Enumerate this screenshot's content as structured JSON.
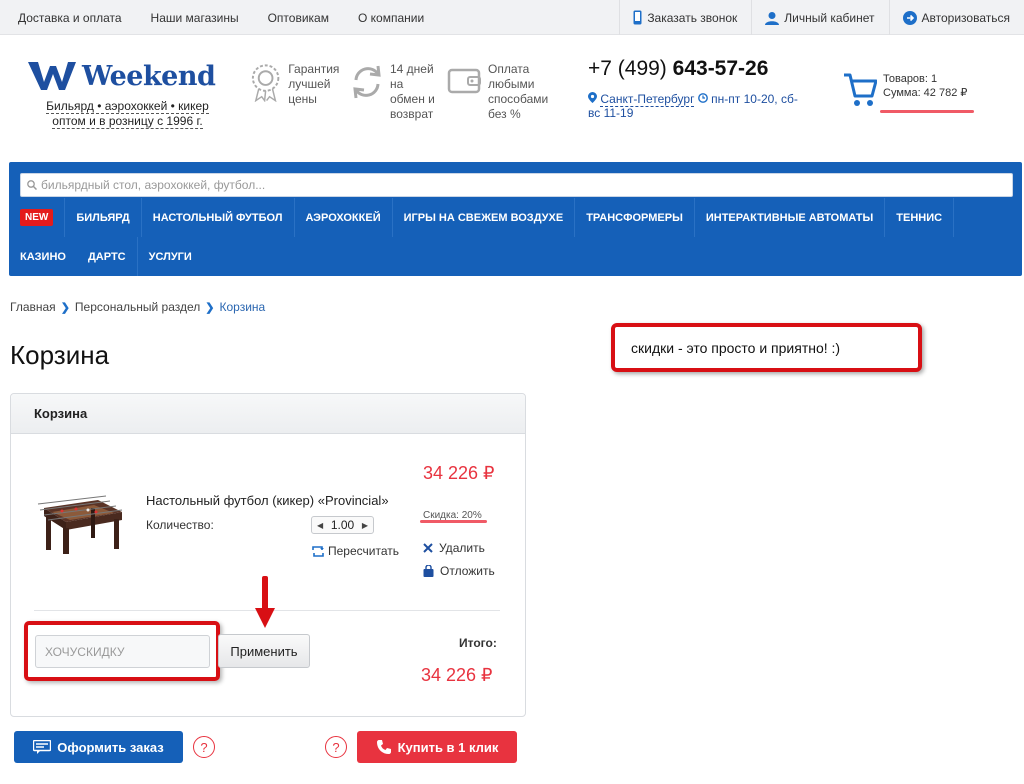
{
  "colors": {
    "brand_blue": "#1560b8",
    "accent_red": "#e8333f",
    "annotation_red": "#d80f14"
  },
  "topbar": {
    "links": [
      "Доставка и оплата",
      "Наши магазины",
      "Оптовикам",
      "О компании"
    ],
    "callback": "Заказать звонок",
    "account": "Личный кабинет",
    "login": "Авторизоваться"
  },
  "header": {
    "logo": "Weekend",
    "tagline": "Бильярд • аэрохоккей • кикер оптом и в розницу с 1996 г.",
    "features": [
      {
        "icon": "medal-icon",
        "text": "Гарантия лучшей цены"
      },
      {
        "icon": "exchange-icon",
        "text": "14 дней на обмен и возврат"
      },
      {
        "icon": "wallet-icon",
        "text": "Оплата любыми способами без %"
      }
    ],
    "phone_prefix": "+7 (499)",
    "phone_main": "643-57-26",
    "city": "Санкт-Петербург",
    "hours": "пн-пт 10-20, сб-вс 11-19",
    "cart_count": "Товаров: 1",
    "cart_sum": "Сумма: 42 782 ₽"
  },
  "search": {
    "placeholder": "бильярдный стол, аэрохоккей, футбол..."
  },
  "menu": {
    "new_badge": "NEW",
    "items": [
      "БИЛЬЯРД",
      "НАСТОЛЬНЫЙ ФУТБОЛ",
      "АЭРОХОККЕЙ",
      "ИГРЫ НА СВЕЖЕМ ВОЗДУХЕ",
      "ТРАНСФОРМЕРЫ",
      "ИНТЕРАКТИВНЫЕ АВТОМАТЫ",
      "ТЕННИС",
      "КАЗИНО",
      "ДАРТС",
      "УСЛУГИ"
    ]
  },
  "breadcrumb": [
    "Главная",
    "Персональный раздел",
    "Корзина"
  ],
  "page_title": "Корзина",
  "annotation": "скидки - это просто и приятно! :)",
  "cart": {
    "panel_title": "Корзина",
    "product_name": "Настольный футбол (кикер) «Provincial»",
    "qty_label": "Количество:",
    "qty_value": "1.00",
    "recalc": "Пересчитать",
    "price": "34 226 ₽",
    "discount": "Скидка: 20%",
    "delete": "Удалить",
    "postpone": "Отложить",
    "coupon_placeholder": "ХОЧУСКИДКУ",
    "apply": "Применить",
    "total_label": "Итого:",
    "total_value": "34 226 ₽"
  },
  "footer_buttons": {
    "order": "Оформить заказ",
    "buy_one_click": "Купить в 1 клик",
    "help": "?"
  }
}
